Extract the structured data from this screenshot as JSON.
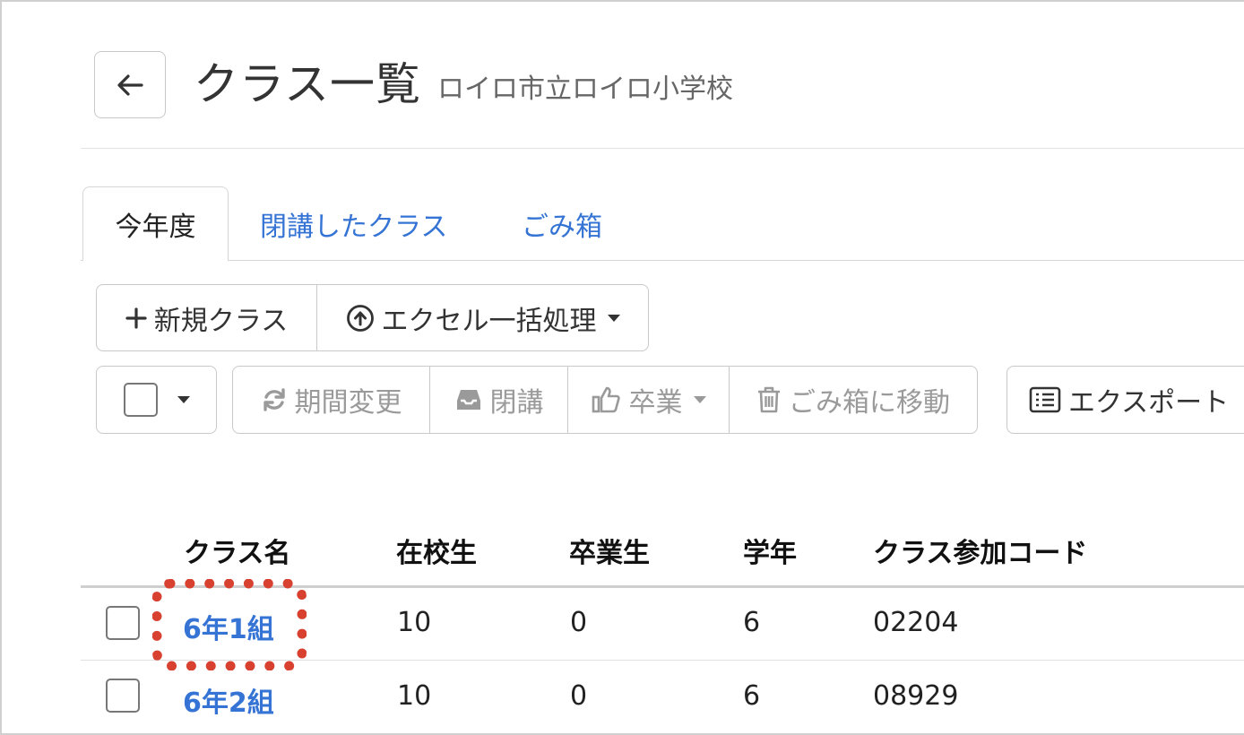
{
  "header": {
    "back_icon": "arrow-left-icon",
    "title": "クラス一覧",
    "subtitle": "ロイロ市立ロイロ小学校"
  },
  "tabs": [
    {
      "label": "今年度",
      "active": true
    },
    {
      "label": "閉講したクラス",
      "active": false
    },
    {
      "label": "ごみ箱",
      "active": false
    }
  ],
  "toolbar_primary": {
    "new_class_label": "新規クラス",
    "new_class_icon": "plus-icon",
    "excel_label": "エクセル一括処理",
    "excel_icon": "upload-circle-icon"
  },
  "toolbar_actions": {
    "change_period_label": "期間変更",
    "change_period_icon": "refresh-icon",
    "close_label": "閉講",
    "close_icon": "inbox-icon",
    "graduate_label": "卒業",
    "graduate_icon": "thumbs-up-icon",
    "trash_label": "ごみ箱に移動",
    "trash_icon": "trash-icon",
    "export_label": "エクスポート",
    "export_icon": "list-icon"
  },
  "table": {
    "columns": [
      "クラス名",
      "在校生",
      "卒業生",
      "学年",
      "クラス参加コード"
    ],
    "rows": [
      {
        "name": "6年1組",
        "students": "10",
        "graduates": "0",
        "grade": "6",
        "code": "02204"
      },
      {
        "name": "6年2組",
        "students": "10",
        "graduates": "0",
        "grade": "6",
        "code": "08929"
      }
    ]
  },
  "colors": {
    "link": "#3574d4",
    "highlight": "#d8402f",
    "disabled": "#9a9a9a"
  }
}
